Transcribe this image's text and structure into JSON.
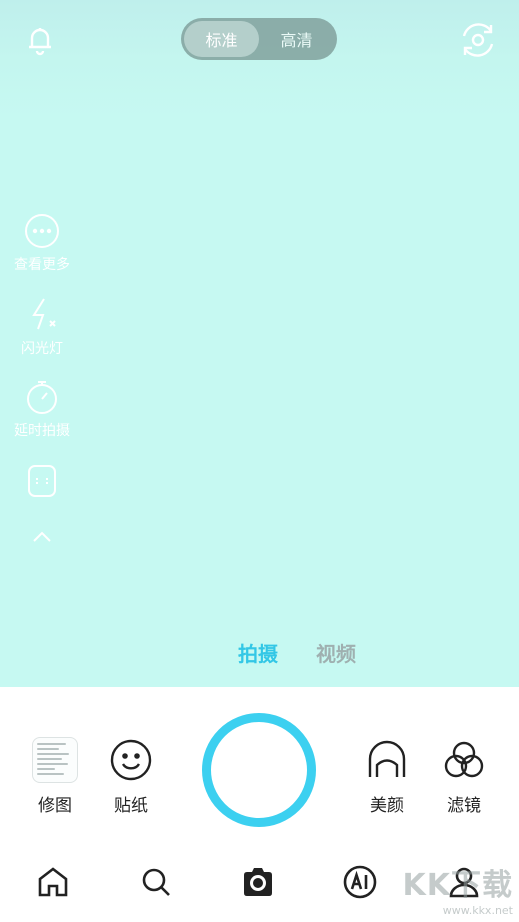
{
  "top_bar": {
    "quality_options": [
      "标准",
      "高清"
    ],
    "selected_quality": "标准",
    "icons": [
      "bell-icon",
      "switch-camera-icon"
    ]
  },
  "side_tools": [
    {
      "icon": "more-icon",
      "label": "查看更多"
    },
    {
      "icon": "flash-off-icon",
      "label": "闪光灯"
    },
    {
      "icon": "timer-icon",
      "label": "延时拍摄"
    },
    {
      "icon": "aspect-ratio-icon",
      "label": ""
    },
    {
      "icon": "chevron-up-icon",
      "label": ""
    }
  ],
  "mode_tabs": {
    "photo": "拍摄",
    "video": "视频",
    "selected": "拍摄"
  },
  "controls": {
    "edit_label": "修图",
    "sticker_label": "贴纸",
    "beauty_label": "美颜",
    "filter_label": "滤镜"
  },
  "bottom_nav": [
    "home-icon",
    "search-icon",
    "camera-icon",
    "ai-icon",
    "profile-icon"
  ],
  "watermark": {
    "main": "KK下载",
    "sub": "www.kkx.net"
  },
  "colors": {
    "viewfinder": "#c6f9f2",
    "accent": "#3cd0f0",
    "active_tab": "#33c7e6"
  }
}
